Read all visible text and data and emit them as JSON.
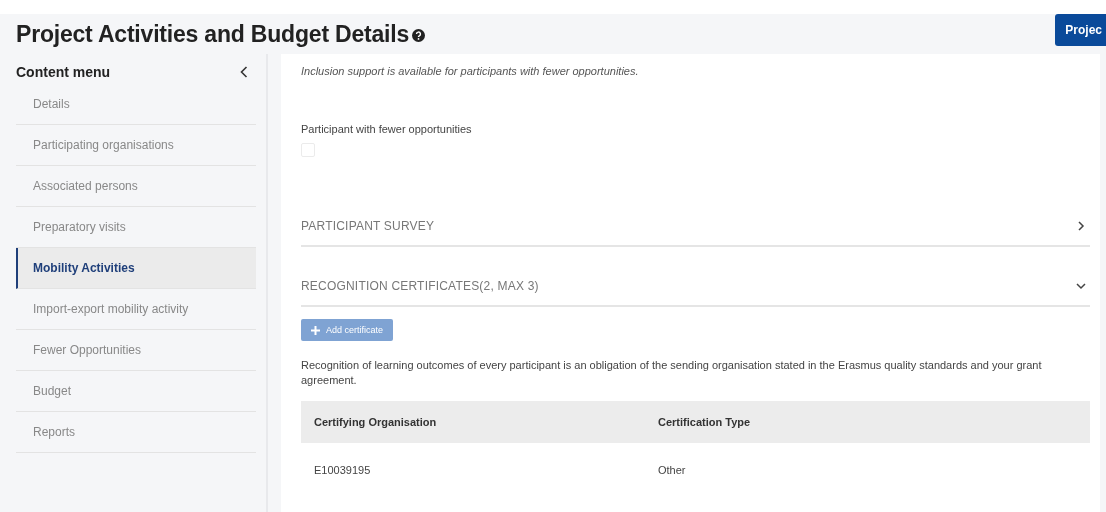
{
  "page_title": "Project Activities and Budget Details",
  "header_button": "Projec",
  "sidebar": {
    "title": "Content menu",
    "items": [
      {
        "label": "Details",
        "selected": false
      },
      {
        "label": "Participating organisations",
        "selected": false
      },
      {
        "label": "Associated persons",
        "selected": false
      },
      {
        "label": "Preparatory visits",
        "selected": false
      },
      {
        "label": "Mobility Activities",
        "selected": true
      },
      {
        "label": "Import-export mobility activity",
        "selected": false
      },
      {
        "label": "Fewer Opportunities",
        "selected": false
      },
      {
        "label": "Budget",
        "selected": false
      },
      {
        "label": "Reports",
        "selected": false
      }
    ]
  },
  "inclusion_note": "Inclusion support is available for participants with fewer opportunities.",
  "fewer_opportunities": {
    "label": "Participant with fewer opportunities",
    "checked": false,
    "disabled": true
  },
  "sections": [
    {
      "title": "PARTICIPANT SURVEY",
      "expanded": false
    },
    {
      "title": "RECOGNITION CERTIFICATES(2, MAX 3)",
      "expanded": true
    }
  ],
  "add_button": {
    "label": "Add certificate",
    "disabled": true
  },
  "recognition_note": "Recognition of learning outcomes of every participant is an obligation of the sending organisation stated in the Erasmus quality standards and your grant agreement.",
  "table": {
    "columns": [
      "Certifying Organisation",
      "Certification Type"
    ],
    "rows": [
      [
        "E10039195",
        "Other"
      ]
    ]
  }
}
